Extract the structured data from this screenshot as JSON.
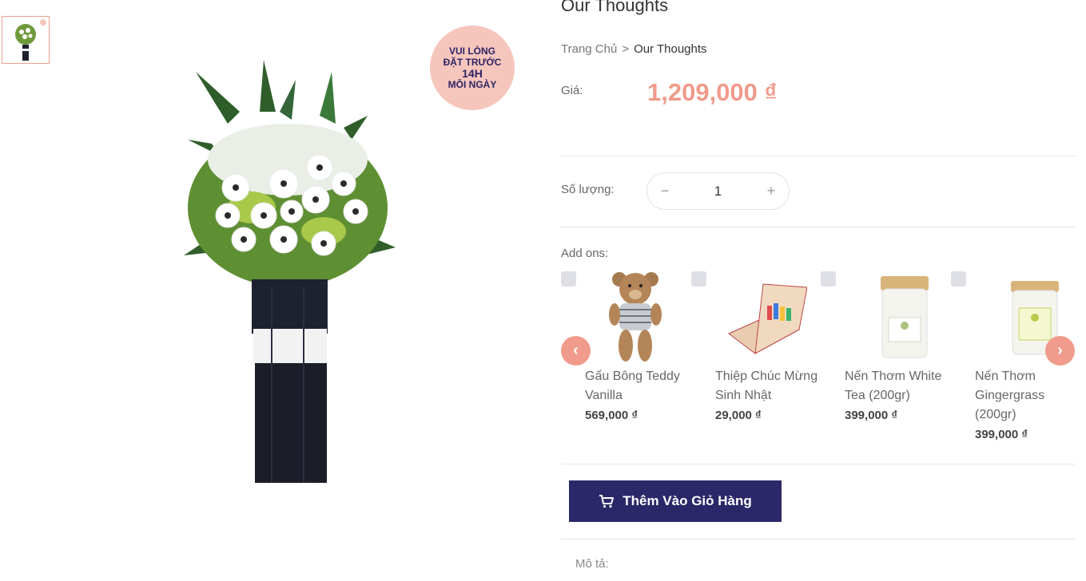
{
  "product": {
    "title": "Our Thoughts",
    "badge": {
      "line1": "VUI LÒNG",
      "line2": "ĐẶT TRƯỚC",
      "line3": "14H",
      "line4": "MỖI NGÀY"
    }
  },
  "breadcrumb": {
    "home": "Trang Chủ",
    "separator": ">",
    "current": "Our Thoughts"
  },
  "price": {
    "label": "Giá:",
    "value": "1,209,000 ₫"
  },
  "quantity": {
    "label": "Số lượng:",
    "minus": "−",
    "value": "1",
    "plus": "+"
  },
  "addons": {
    "label": "Add ons:",
    "items": [
      {
        "name": "Gấu Bông Teddy Vanilla",
        "price": "569,000 ₫"
      },
      {
        "name": "Thiệp Chúc Mừng Sinh Nhật",
        "price": "29,000 ₫"
      },
      {
        "name": "Nến Thơm White Tea (200gr)",
        "price": "399,000 ₫"
      },
      {
        "name": "Nến Thơm Gingergrass (200gr)",
        "price": "399,000 ₫"
      }
    ],
    "prev": "‹",
    "next": "›"
  },
  "cart_button": {
    "label": "Thêm Vào Giỏ Hàng",
    "icon": "cart-icon"
  },
  "description": {
    "label": "Mô tả:"
  },
  "colors": {
    "accent": "#f09b8b",
    "primary": "#2b2869",
    "badge_bg": "#f6c6bd"
  }
}
